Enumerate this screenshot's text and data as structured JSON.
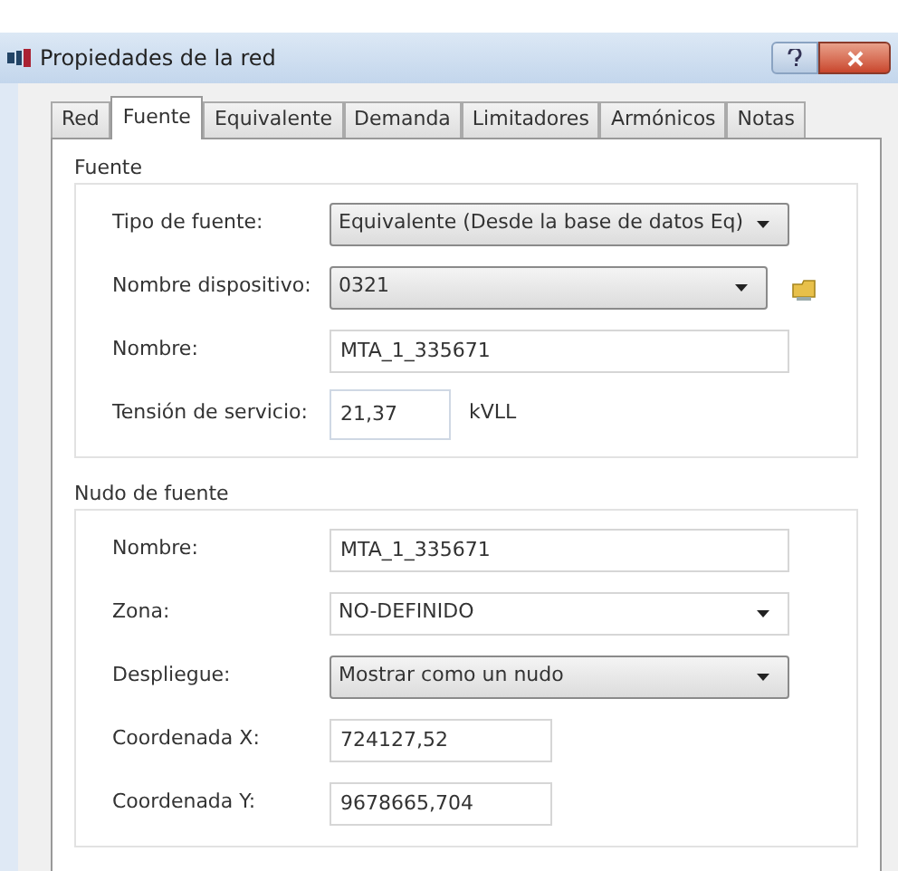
{
  "window": {
    "title": "Propiedades de la red"
  },
  "tabs": [
    {
      "label": "Red",
      "selected": false
    },
    {
      "label": "Fuente",
      "selected": true
    },
    {
      "label": "Equivalente",
      "selected": false
    },
    {
      "label": "Demanda",
      "selected": false
    },
    {
      "label": "Limitadores",
      "selected": false
    },
    {
      "label": "Armónicos",
      "selected": false
    },
    {
      "label": "Notas",
      "selected": false
    }
  ],
  "groups": [
    {
      "title": "Fuente",
      "rows": [
        {
          "label": "Tipo de fuente:",
          "kind": "combo",
          "value": "Equivalente (Desde la base de datos Eq)"
        },
        {
          "label": "Nombre dispositivo:",
          "kind": "combo",
          "value": "0321",
          "action": true
        },
        {
          "label": "Nombre:",
          "kind": "text",
          "value": "MTA_1_335671"
        },
        {
          "label": "Tensión de servicio:",
          "kind": "short",
          "value": "21,37",
          "unit": "kVLL"
        }
      ]
    },
    {
      "title": "Nudo de fuente",
      "rows": [
        {
          "label": "Nombre:",
          "kind": "text",
          "value": "MTA_1_335671"
        },
        {
          "label": "Zona:",
          "kind": "dropdown",
          "value": "NO-DEFINIDO"
        },
        {
          "label": "Despliegue:",
          "kind": "combo",
          "value": "Mostrar como un nudo"
        },
        {
          "label": "Coordenada X:",
          "kind": "medium",
          "value": "724127,52"
        },
        {
          "label": "Coordenada Y:",
          "kind": "medium",
          "value": "9678665,704"
        }
      ]
    }
  ]
}
